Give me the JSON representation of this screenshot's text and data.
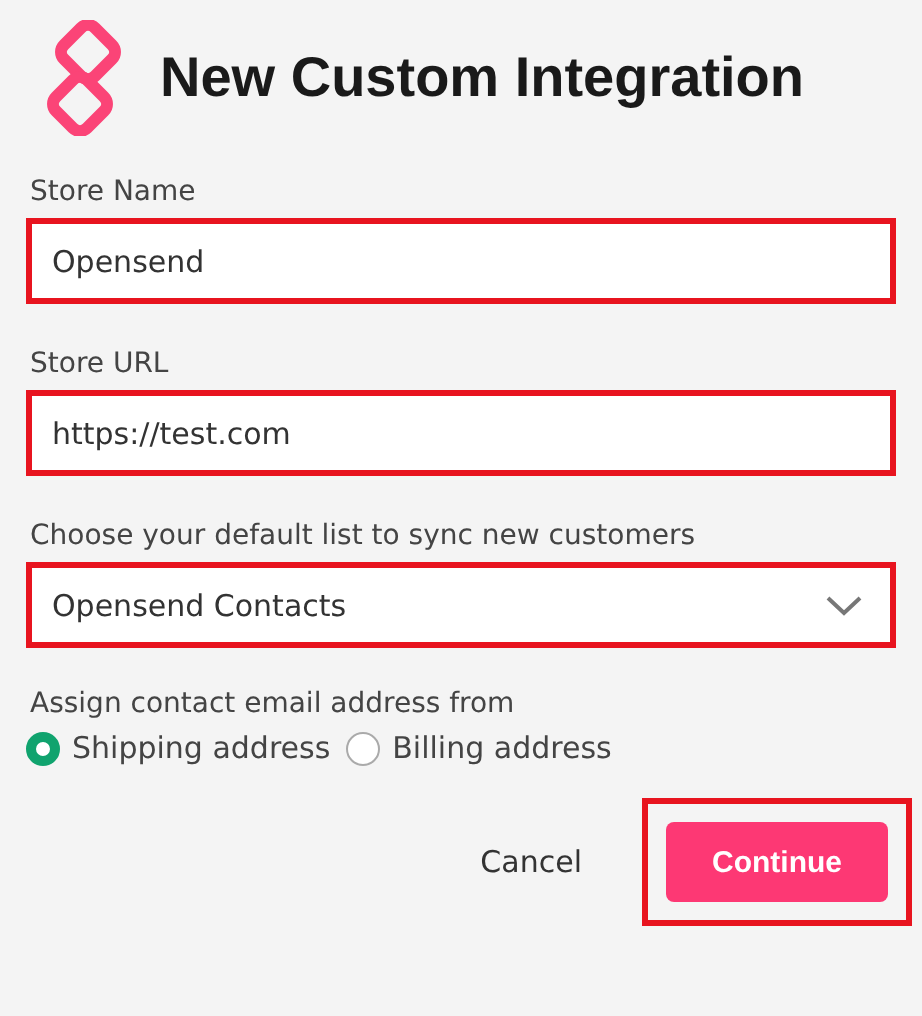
{
  "title": "New Custom Integration",
  "fields": [
    {
      "kind": "text",
      "label": "Store Name",
      "value": "Opensend",
      "highlighted": true
    },
    {
      "kind": "text",
      "label": "Store URL",
      "value": "https://test.com",
      "highlighted": true
    },
    {
      "kind": "select",
      "label": "Choose your default list to sync new customers",
      "value": "Opensend Contacts",
      "highlighted": true
    }
  ],
  "email_source": {
    "label": "Assign contact email address from",
    "options": [
      {
        "label": "Shipping address",
        "selected": true
      },
      {
        "label": "Billing address",
        "selected": false
      }
    ]
  },
  "buttons": [
    {
      "kind": "secondary",
      "label": "Cancel",
      "highlighted": false
    },
    {
      "kind": "primary",
      "label": "Continue",
      "highlighted": true
    }
  ]
}
